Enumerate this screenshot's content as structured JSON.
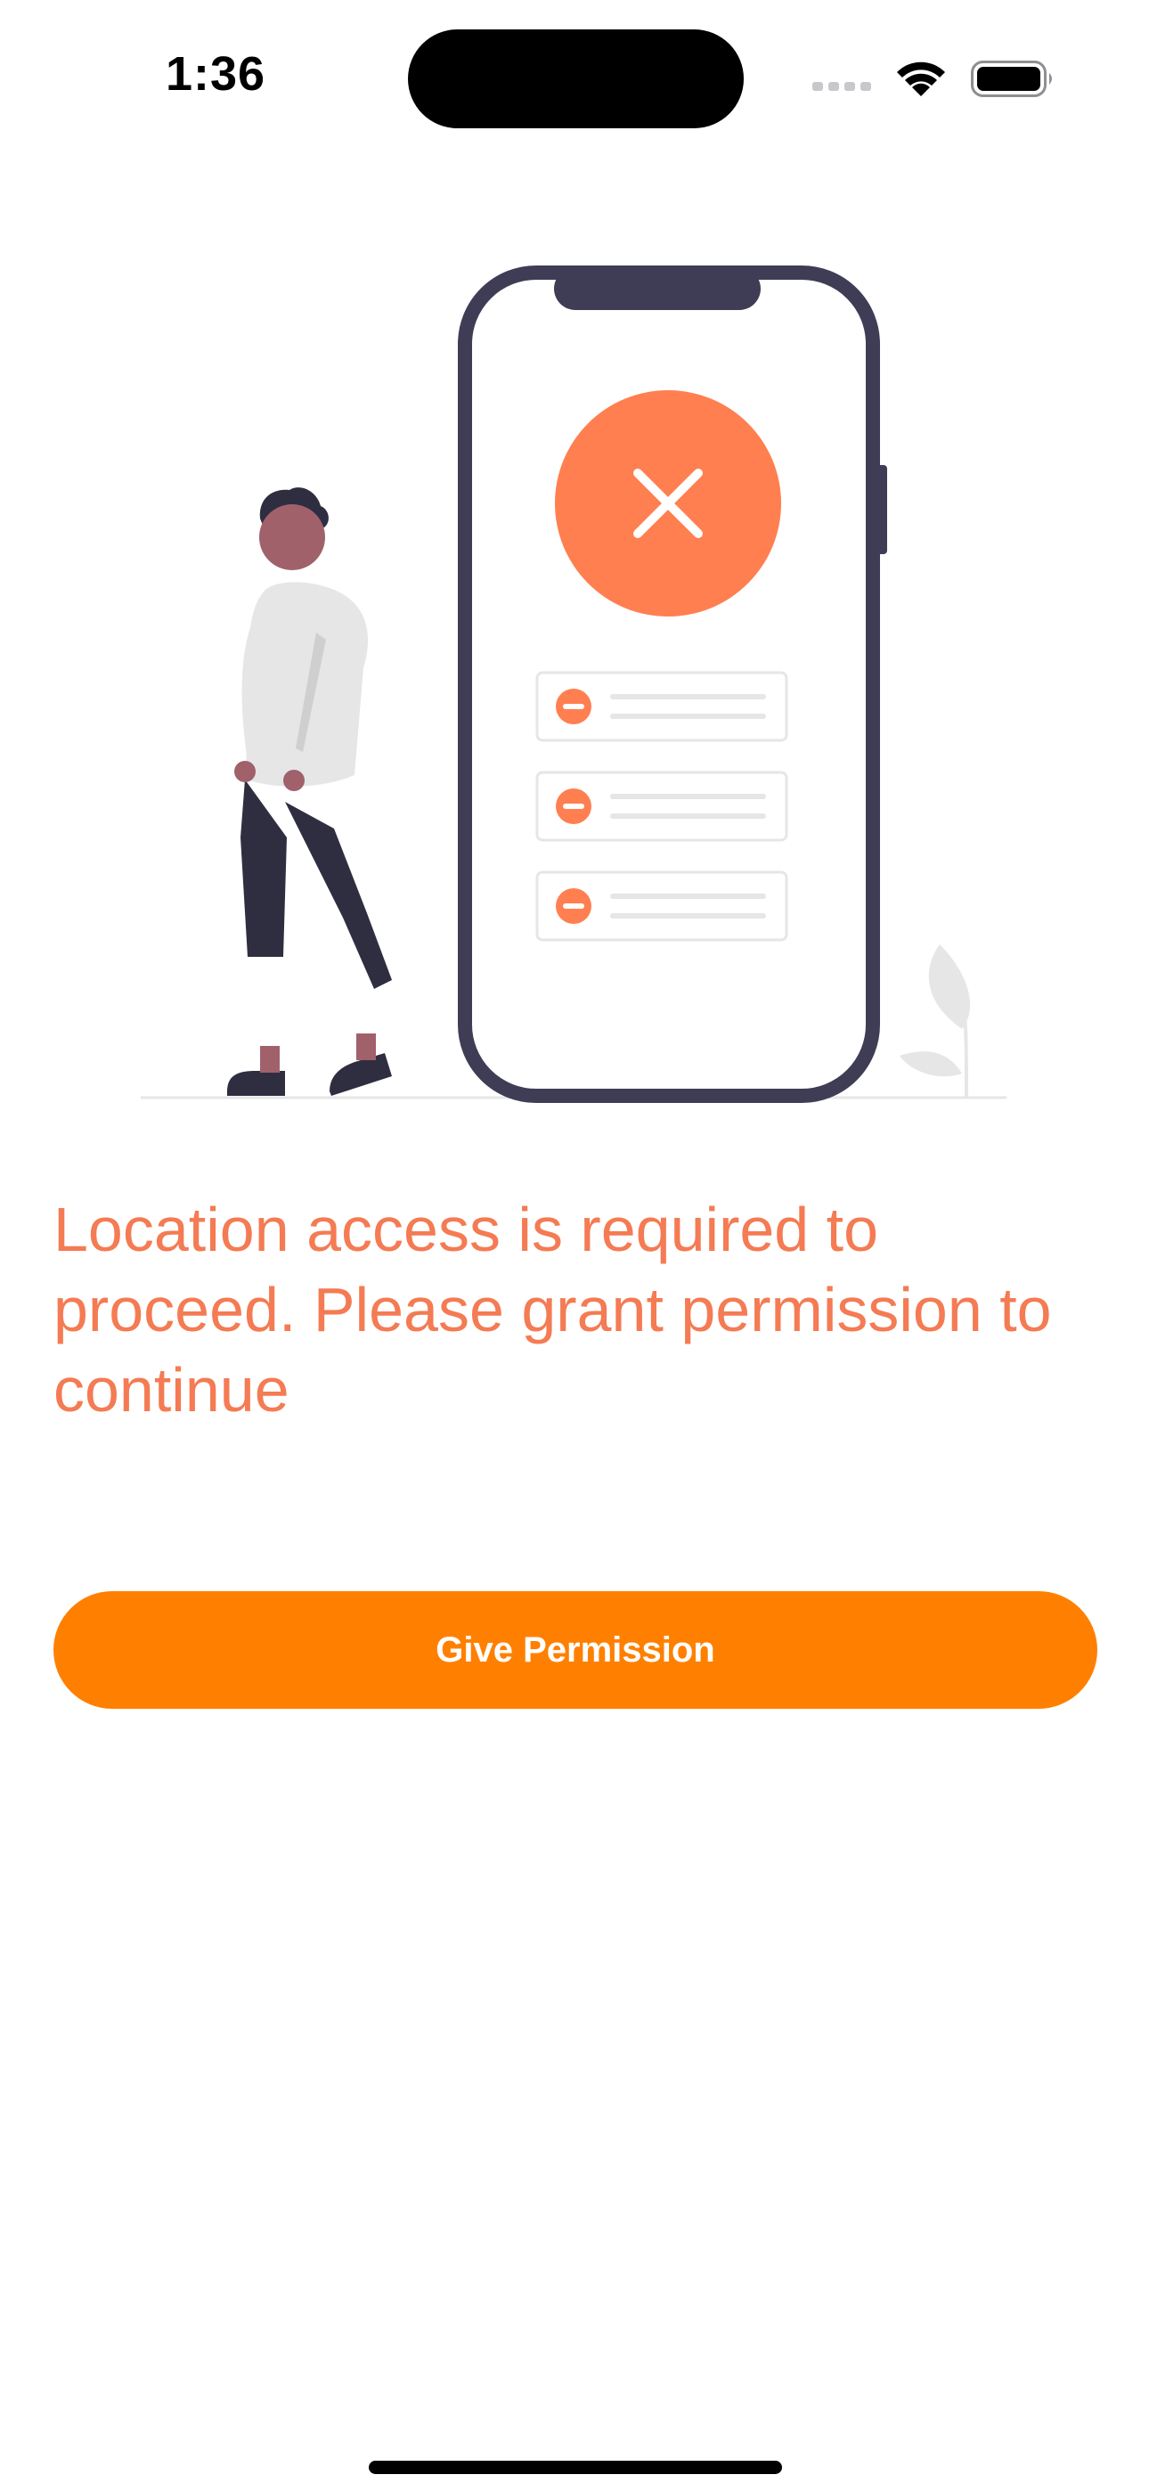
{
  "status_bar": {
    "time": "1:36"
  },
  "icons": {
    "signal": "cellular-signal-icon",
    "wifi": "wifi-icon",
    "battery": "battery-icon",
    "denied": "close-x-icon",
    "list_item": "minus-circle-icon",
    "plant": "leaf-plant-icon"
  },
  "main": {
    "message": "Location access is required to proceed. Please grant permission to continue",
    "button_label": "Give Permission"
  },
  "colors": {
    "accent": "#F47B53",
    "button": "#FF8000",
    "phone_frame": "#3F3D56",
    "text_on_button": "#FFFFFF"
  }
}
